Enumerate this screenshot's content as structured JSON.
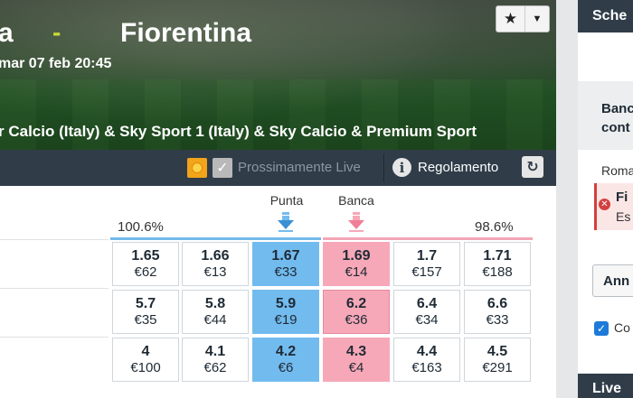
{
  "event": {
    "team1": "a",
    "separator": "-",
    "team2": "Fiorentina",
    "date": "mar 07 feb 20:45",
    "channels": "r Calcio (Italy) & Sky Sport 1 (Italy) & Sky Calcio & Premium Sport"
  },
  "favourite": {
    "star_icon": "star-icon",
    "caret_icon": "chevron-down-icon"
  },
  "toolbar": {
    "upcoming_live": "Prossimamente Live",
    "rules": "Regolamento",
    "info_glyph": "i",
    "refresh_glyph": "↻",
    "check_glyph": "✓"
  },
  "market": {
    "back_label": "Punta",
    "lay_label": "Banca",
    "back_book": "100.6%",
    "lay_book": "98.6%",
    "colors": {
      "back": "#72bbef",
      "lay": "#f7a8b8"
    },
    "rows": [
      {
        "prices": [
          {
            "odds": "1.65",
            "amount": "€62"
          },
          {
            "odds": "1.66",
            "amount": "€13"
          },
          {
            "odds": "1.67",
            "amount": "€33"
          },
          {
            "odds": "1.69",
            "amount": "€14"
          },
          {
            "odds": "1.7",
            "amount": "€157"
          },
          {
            "odds": "1.71",
            "amount": "€188"
          }
        ]
      },
      {
        "prices": [
          {
            "odds": "5.7",
            "amount": "€35"
          },
          {
            "odds": "5.8",
            "amount": "€44"
          },
          {
            "odds": "5.9",
            "amount": "€19"
          },
          {
            "odds": "6.2",
            "amount": "€36"
          },
          {
            "odds": "6.4",
            "amount": "€34"
          },
          {
            "odds": "6.6",
            "amount": "€33"
          }
        ]
      },
      {
        "prices": [
          {
            "odds": "4",
            "amount": "€100"
          },
          {
            "odds": "4.1",
            "amount": "€62"
          },
          {
            "odds": "4.2",
            "amount": "€6"
          },
          {
            "odds": "4.3",
            "amount": "€4"
          },
          {
            "odds": "4.4",
            "amount": "€163"
          },
          {
            "odds": "4.5",
            "amount": "€291"
          }
        ]
      }
    ]
  },
  "sidebar": {
    "header": "Sche",
    "bank_line1": "Banc",
    "bank_line2": "cont",
    "selection_market": "Roma",
    "error_title": "Fi",
    "error_text": "Es",
    "cancel_button": "Ann",
    "confirm_label": "Co",
    "checkbox_glyph": "✓",
    "error_glyph": "✕",
    "live_header": "Live"
  }
}
